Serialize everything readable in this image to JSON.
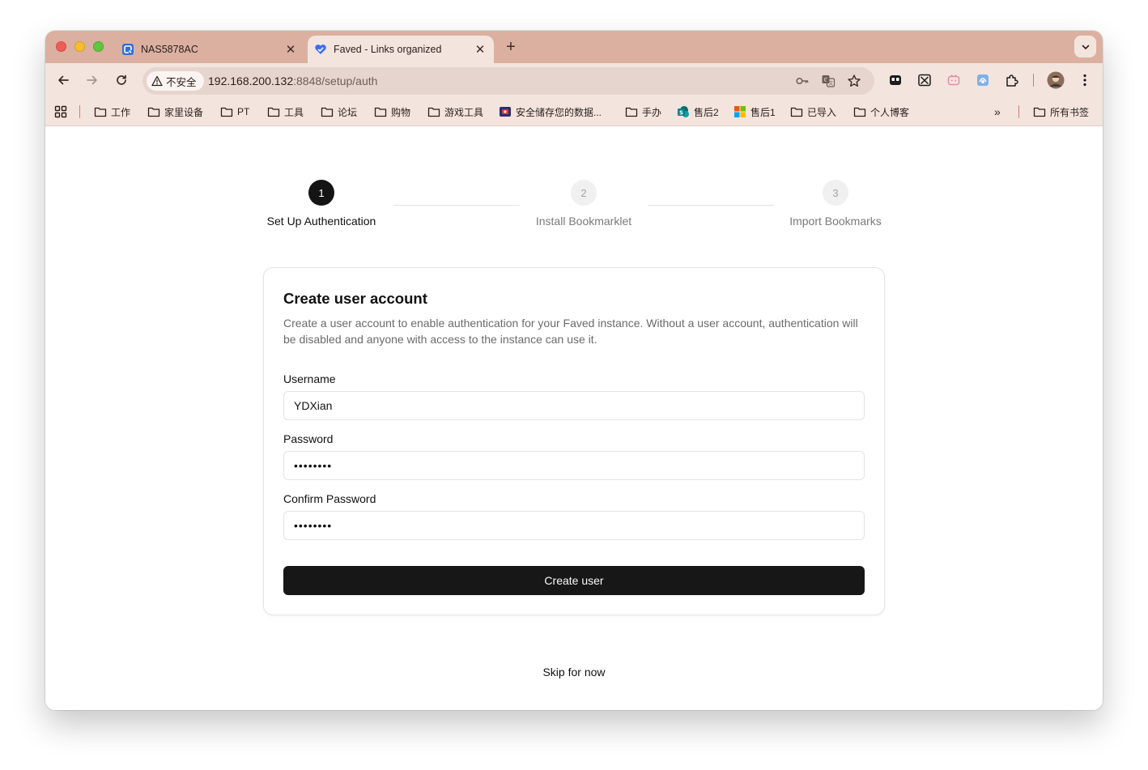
{
  "browser": {
    "tabs": [
      {
        "title": "NAS5878AC",
        "icon": "nas-app-icon",
        "active": false
      },
      {
        "title": "Faved - Links organized",
        "icon": "faved-heart-icon",
        "active": true
      }
    ],
    "address": {
      "security_label": "不安全",
      "host": "192.168.200.132",
      "port_path": ":8848/setup/auth"
    },
    "bookmarks": [
      {
        "label": "工作",
        "icon": "folder-icon"
      },
      {
        "label": "家里设备",
        "icon": "folder-icon"
      },
      {
        "label": "PT",
        "icon": "folder-icon"
      },
      {
        "label": "工具",
        "icon": "folder-icon"
      },
      {
        "label": "论坛",
        "icon": "folder-icon"
      },
      {
        "label": "购物",
        "icon": "folder-icon"
      },
      {
        "label": "游戏工具",
        "icon": "folder-icon"
      },
      {
        "label": "安全储存您的数据...",
        "icon": "site-icon"
      },
      {
        "label": "手办",
        "icon": "folder-icon"
      },
      {
        "label": "售后2",
        "icon": "sharepoint-icon"
      },
      {
        "label": "售后1",
        "icon": "microsoft-icon"
      },
      {
        "label": "已导入",
        "icon": "folder-icon"
      },
      {
        "label": "个人博客",
        "icon": "folder-icon"
      }
    ],
    "all_bookmarks_label": "所有书签",
    "overflow_label": "»"
  },
  "stepper": {
    "steps": [
      {
        "number": "1",
        "label": "Set Up Authentication",
        "state": "active"
      },
      {
        "number": "2",
        "label": "Install Bookmarklet",
        "state": "inactive"
      },
      {
        "number": "3",
        "label": "Import Bookmarks",
        "state": "inactive"
      }
    ]
  },
  "form": {
    "title": "Create user account",
    "description": "Create a user account to enable authentication for your Faved instance. Without a user account, authentication will be disabled and anyone with access to the instance can use it.",
    "username_label": "Username",
    "username_value": "YDXian",
    "password_label": "Password",
    "password_value": "••••••••",
    "confirm_label": "Confirm Password",
    "confirm_value": "••••••••",
    "submit_label": "Create user"
  },
  "skip_label": "Skip for now",
  "colors": {
    "tabstrip": "#dbb0a0",
    "toolbar": "#f3e5de",
    "primary": "#171717",
    "step_active": "#141414",
    "step_inactive": "#f0f0f0"
  }
}
